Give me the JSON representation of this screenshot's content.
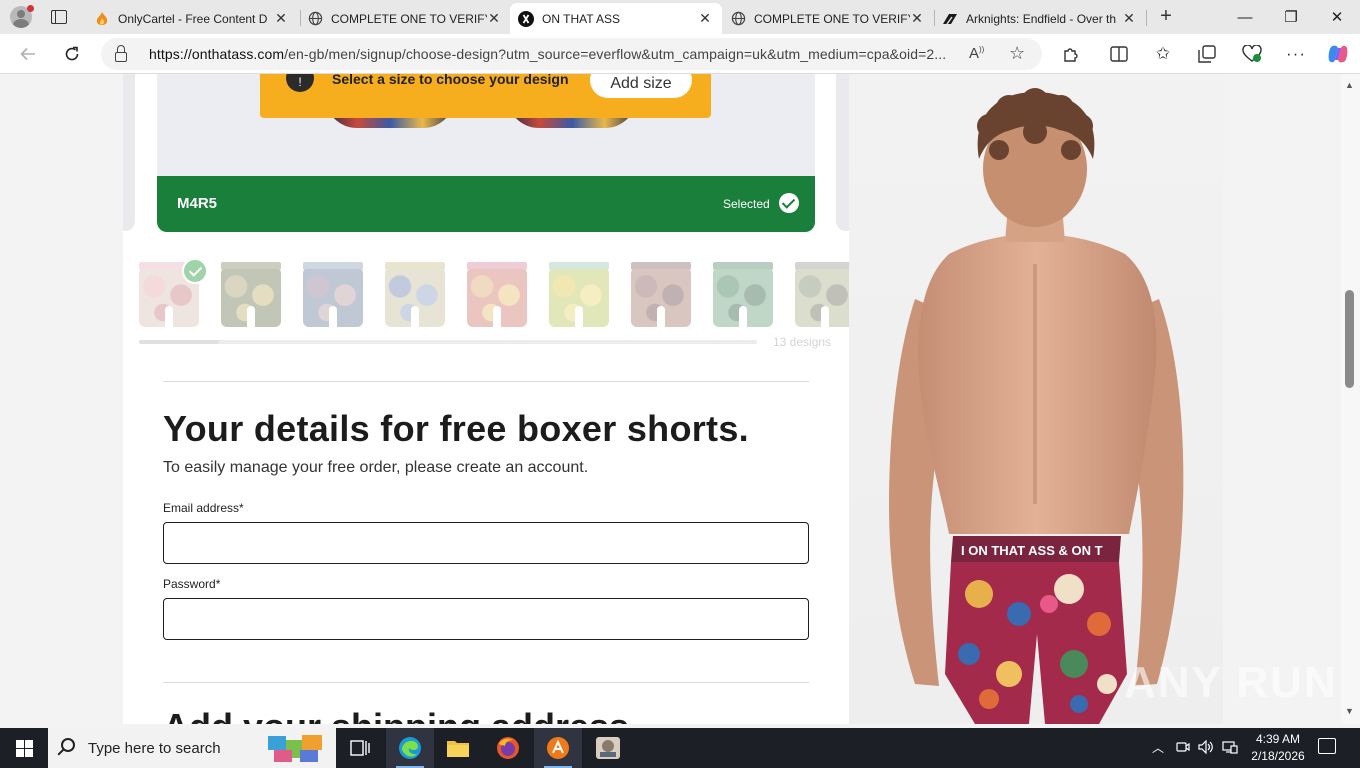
{
  "browser": {
    "tabs": [
      {
        "title": "OnlyCartel - Free Content D",
        "active": false
      },
      {
        "title": "COMPLETE ONE TO VERIFY",
        "active": false
      },
      {
        "title": "ON THAT ASS",
        "active": true
      },
      {
        "title": "COMPLETE ONE TO VERIFY",
        "active": false
      },
      {
        "title": "Arknights: Endfield - Over th",
        "active": false
      }
    ],
    "new_tab": "+",
    "window_controls": {
      "minimize": "—",
      "maximize": "❐",
      "close": "✕"
    },
    "url_host": "https://onthatass.com",
    "url_path": "/en-gb/men/signup/choose-design?utm_source=everflow&utm_campaign=uk&utm_medium=cpa&oid=2..."
  },
  "page": {
    "size_banner": {
      "info": "!",
      "text": "Select a size to choose your design",
      "button": "Add size"
    },
    "selected_design": {
      "code": "M4R5",
      "status": "Selected"
    },
    "designs_count": "13 designs",
    "thumbnails": [
      {
        "band": "#e9b4c2",
        "colors": [
          "#e9a8a8",
          "#d9c2b8",
          "#c77c7c"
        ]
      },
      {
        "band": "#8c8c6a",
        "colors": [
          "#a8a070",
          "#6d7a55",
          "#c2b070"
        ]
      },
      {
        "band": "#8ea1b8",
        "colors": [
          "#8c7a90",
          "#6a7da0",
          "#b89aa0"
        ]
      },
      {
        "band": "#c9c08a",
        "colors": [
          "#6f86b0",
          "#c8c0a0",
          "#8aa0c0"
        ]
      },
      {
        "band": "#d88aa0",
        "colors": [
          "#e0a870",
          "#d07a6a",
          "#e8c070"
        ]
      },
      {
        "band": "#9fc6b8",
        "colors": [
          "#e0c84a",
          "#b8c85a",
          "#e8d870"
        ]
      },
      {
        "band": "#8a6a6a",
        "colors": [
          "#8a5a5a",
          "#a87a6a",
          "#6a4a4a"
        ]
      },
      {
        "band": "#5a8a6a",
        "colors": [
          "#3a7a4a",
          "#6aa07a",
          "#2f5f3f"
        ]
      },
      {
        "band": "#9a9a9a",
        "colors": [
          "#7a8a6a",
          "#aab08a",
          "#6a6a5a"
        ]
      }
    ],
    "heading": "Your details for free boxer shorts.",
    "subtext": "To easily manage your free order, please create an account.",
    "email_label": "Email address*",
    "email_value": "",
    "password_label": "Password*",
    "password_value": "",
    "next_heading": "Add your shipping address",
    "product_waistband_text": "I ON THAT ASS & ON T",
    "watermark": "ANY RUN"
  },
  "taskbar": {
    "search_placeholder": "Type here to search",
    "time": "4:39 AM",
    "date": "2/18/2026"
  },
  "colors": {
    "selected_green": "#1a7f3a",
    "banner_orange": "#f6ad1e",
    "edge_blue": "#0078d4"
  }
}
